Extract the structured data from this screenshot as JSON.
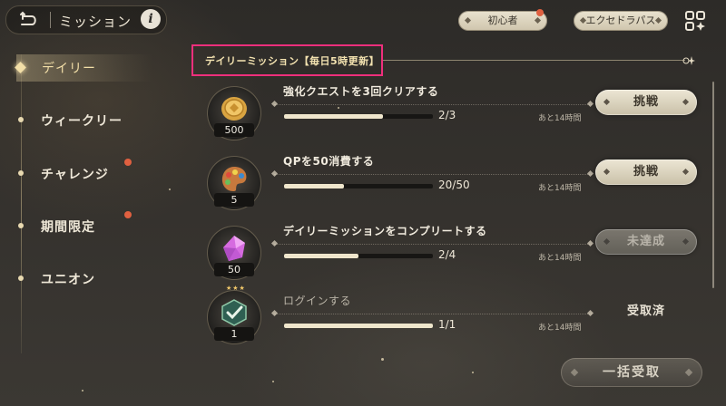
{
  "header": {
    "title": "ミッション",
    "back_icon": "back-arrow-icon",
    "info_icon": "info-icon",
    "info_glyph": "i"
  },
  "top_right": {
    "beginner_label": "初心者",
    "extra_label": "エクセドラパス",
    "menu_icon": "grid-menu-icon"
  },
  "sidebar": {
    "items": [
      {
        "label": "デイリー",
        "active": true,
        "notification": false
      },
      {
        "label": "ウィークリー",
        "active": false,
        "notification": false
      },
      {
        "label": "チャレンジ",
        "active": false,
        "notification": true
      },
      {
        "label": "期間限定",
        "active": false,
        "notification": true
      },
      {
        "label": "ユニオン",
        "active": false,
        "notification": false
      }
    ]
  },
  "section": {
    "title": "デイリーミッション【毎日5時更新】"
  },
  "missions": [
    {
      "title": "強化クエストを3回クリアする",
      "progress_text": "2/3",
      "progress": 0.667,
      "time_left": "あと14時間",
      "reward_icon": "gold-coin-icon",
      "reward_qty": "500",
      "action": "挑戦",
      "state": "active"
    },
    {
      "title": "QPを50消費する",
      "progress_text": "20/50",
      "progress": 0.4,
      "time_left": "あと14時間",
      "reward_icon": "palette-icon",
      "reward_qty": "5",
      "action": "挑戦",
      "state": "active"
    },
    {
      "title": "デイリーミッションをコンプリートする",
      "progress_text": "2/4",
      "progress": 0.5,
      "time_left": "あと14時間",
      "reward_icon": "pink-crystal-icon",
      "reward_qty": "50",
      "action": "未達成",
      "state": "incomplete"
    },
    {
      "title": "ログインする",
      "progress_text": "1/1",
      "progress": 1.0,
      "time_left": "あと14時間",
      "reward_icon": "green-ticket-icon",
      "reward_qty": "1",
      "action": "受取済",
      "state": "claimed"
    }
  ],
  "claim_all_label": "一括受取",
  "colors": {
    "highlight_border": "#ee2f7c",
    "notification": "#e06040",
    "accent_gold": "#f3dfa8"
  }
}
